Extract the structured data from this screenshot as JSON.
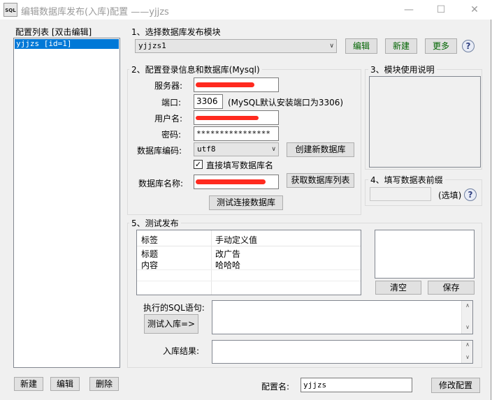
{
  "window": {
    "icon_text": "SQL",
    "title": "编辑数据库发布(入库)配置 ——yjjzs"
  },
  "left": {
    "header": "配置列表 [双击编辑]",
    "items": [
      "yjjzs [id=1]"
    ],
    "buttons": {
      "new": "新建",
      "edit": "编辑",
      "delete": "删除"
    }
  },
  "section1": {
    "title": "1、选择数据库发布模块",
    "module_selected": "yjjzs1",
    "buttons": {
      "edit": "编辑",
      "new": "新建",
      "more": "更多"
    }
  },
  "section2": {
    "title": "2、配置登录信息和数据库(Mysql)",
    "server_label": "服务器:",
    "port_label": "端口:",
    "port_value": "3306",
    "port_hint": "(MySQL默认安装端口为3306)",
    "user_label": "用户名:",
    "password_label": "密码:",
    "password_value": "****************",
    "charset_label": "数据库编码:",
    "charset_value": "utf8",
    "create_db_button": "创建新数据库",
    "direct_db_checkbox": "直接填写数据库名",
    "direct_db_checked": true,
    "dbname_label": "数据库名称:",
    "get_db_list_button": "获取数据库列表",
    "test_connection_button": "测试连接数据库"
  },
  "section3": {
    "title": "3、模块使用说明"
  },
  "section4": {
    "title": "4、填写数据表前缀",
    "optional": "(选填)"
  },
  "section5": {
    "title": "5、测试发布",
    "table": {
      "headers": [
        "标签",
        "手动定义值"
      ],
      "rows": [
        [
          "标题",
          "改广告"
        ],
        [
          "内容",
          "哈哈哈"
        ]
      ]
    },
    "clear_button": "清空",
    "save_button": "保存",
    "sql_label": "执行的SQL语句:",
    "test_insert_button": "测试入库=>",
    "result_label": "入库结果:"
  },
  "footer": {
    "config_name_label": "配置名:",
    "config_name_value": "yjjzs",
    "modify_button": "修改配置"
  },
  "colors": {
    "selection": "#0078d7",
    "redaction": "#ff2a1f",
    "green_text": "#006400"
  }
}
